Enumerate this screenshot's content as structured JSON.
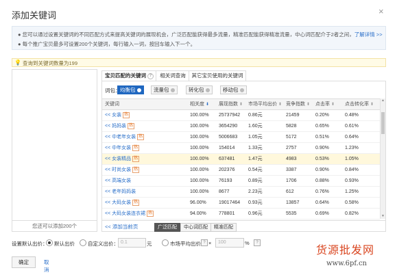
{
  "dialog": {
    "title": "添加关键词",
    "close_icon": "close-icon"
  },
  "info": {
    "line1": "您可以通过设置关键词的不同匹配方式来提高关键词的展现机会，广泛匹配能获得最多流量，精准匹配能获得精准流量，中心词匹配介于2者之间，",
    "link": "了解详情 >>",
    "line2": "每个推广宝贝最多可设置200个关键词，每行输入一词，按回车输入下一个。"
  },
  "notice": {
    "text": "查询到关键词数量为199",
    "icon": "lightbulb-icon"
  },
  "left_box": {
    "footer": "您还可以添加200个"
  },
  "tabs": [
    {
      "label": "宝贝匹配的关键词",
      "active": true
    },
    {
      "label": "相关词查询",
      "active": false
    },
    {
      "label": "其它宝贝使用的关键词",
      "active": false
    }
  ],
  "packages": {
    "label": "词包：",
    "chips": [
      {
        "label": "均衡包",
        "count": "",
        "active": true
      },
      {
        "label": "流量包",
        "count": "",
        "active": false
      },
      {
        "label": "转化包",
        "count": "",
        "active": false
      },
      {
        "label": "移动包",
        "count": "",
        "active": false
      }
    ]
  },
  "table": {
    "headers": [
      "关键词",
      "相关度",
      "展现指数",
      "市场平均出价",
      "竞争指数",
      "点击率",
      "点击转化率"
    ],
    "rows": [
      {
        "kw": "<< 女装",
        "tag": "热",
        "rel": "100.00%",
        "imp": "25737942",
        "bid": "0.86元",
        "comp": "21459",
        "ctr": "0.20%",
        "cvr": "0.48%"
      },
      {
        "kw": "<< 妈妈装",
        "tag": "热",
        "rel": "100.00%",
        "imp": "3654290",
        "bid": "1.60元",
        "comp": "5828",
        "ctr": "0.65%",
        "cvr": "0.61%"
      },
      {
        "kw": "<< 中老年女装",
        "tag": "热",
        "rel": "100.00%",
        "imp": "5006683",
        "bid": "1.05元",
        "comp": "5172",
        "ctr": "0.51%",
        "cvr": "0.64%"
      },
      {
        "kw": "<< 中年女装",
        "tag": "热",
        "rel": "100.00%",
        "imp": "154014",
        "bid": "1.33元",
        "comp": "2757",
        "ctr": "0.90%",
        "cvr": "1.23%"
      },
      {
        "kw": "<< 女装精品",
        "tag": "热",
        "rel": "100.00%",
        "imp": "637481",
        "bid": "1.47元",
        "comp": "4983",
        "ctr": "0.53%",
        "cvr": "1.05%"
      },
      {
        "kw": "<< 时尚女装",
        "tag": "热",
        "rel": "100.00%",
        "imp": "202376",
        "bid": "0.54元",
        "comp": "3387",
        "ctr": "0.90%",
        "cvr": "0.84%"
      },
      {
        "kw": "<< 高端女装",
        "tag": "",
        "rel": "100.00%",
        "imp": "76193",
        "bid": "0.89元",
        "comp": "1706",
        "ctr": "0.88%",
        "cvr": "0.93%"
      },
      {
        "kw": "<< 老年妈妈装",
        "tag": "",
        "rel": "100.00%",
        "imp": "8677",
        "bid": "2.23元",
        "comp": "612",
        "ctr": "0.76%",
        "cvr": "1.25%"
      },
      {
        "kw": "<< 大码女装",
        "tag": "热",
        "rel": "96.00%",
        "imp": "19017464",
        "bid": "0.93元",
        "comp": "13857",
        "ctr": "0.64%",
        "cvr": "0.58%"
      },
      {
        "kw": "<< 大码女装连衣裙",
        "tag": "热",
        "rel": "94.00%",
        "imp": "778801",
        "bid": "0.96元",
        "comp": "5535",
        "ctr": "0.69%",
        "cvr": "0.82%"
      }
    ]
  },
  "footer_bar": {
    "add_link": "<< 添加当前页",
    "match": [
      {
        "label": "广泛匹配",
        "active": true
      },
      {
        "label": "中心词匹配",
        "active": false
      },
      {
        "label": "精准匹配",
        "active": false
      }
    ]
  },
  "bid_settings": {
    "label": "设置默认出价：",
    "opt_default": "默认出价",
    "opt_custom": "自定义出价：",
    "custom_placeholder": "0.1",
    "unit": "元",
    "opt_market": "市场平均出价",
    "times": "×",
    "percent_value": "100",
    "percent_unit": "%"
  },
  "actions": {
    "ok": "确定",
    "cancel": "取消"
  },
  "watermark": {
    "line1": "货源批发网",
    "line2": "www.6pf.cn"
  }
}
